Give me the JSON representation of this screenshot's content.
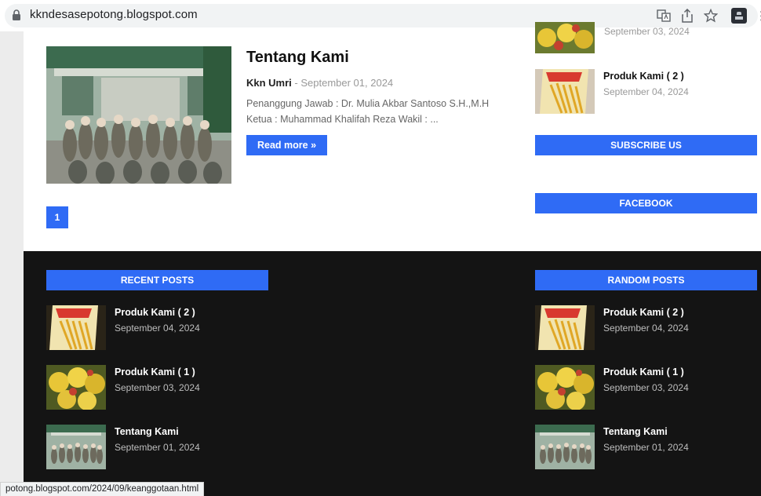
{
  "browser": {
    "url": "kkndesasepotong.blogspot.com",
    "status_url": "potong.blogspot.com/2024/09/keanggotaan.html",
    "more_glyph": "⋮"
  },
  "post": {
    "title": "Tentang Kami",
    "author": "Kkn Umri",
    "separator": " - ",
    "date": "September 01, 2024",
    "excerpt": "Penanggung Jawab : Dr. Mulia Akbar Santoso S.H.,M.H Ketua : Muhammad Khalifah Reza Wakil : ...",
    "read_more": "Read more »"
  },
  "pager": {
    "current": "1"
  },
  "sidebar": {
    "partial_item_date": "September 03, 2024",
    "item": {
      "title": "Produk Kami ( 2 )",
      "date": "September 04, 2024"
    },
    "subscribe_label": "SUBSCRIBE US",
    "facebook_label": "FACEBOOK"
  },
  "footer": {
    "recent_label": "RECENT POSTS",
    "random_label": "RANDOM POSTS",
    "recent": [
      {
        "title": "Produk Kami ( 2 )",
        "date": "September 04, 2024",
        "thumb": "snack"
      },
      {
        "title": "Produk Kami ( 1 )",
        "date": "September 03, 2024",
        "thumb": "fruit"
      },
      {
        "title": "Tentang Kami",
        "date": "September 01, 2024",
        "thumb": "group"
      }
    ],
    "random": [
      {
        "title": "Produk Kami ( 2 )",
        "date": "September 04, 2024",
        "thumb": "snack"
      },
      {
        "title": "Produk Kami ( 1 )",
        "date": "September 03, 2024",
        "thumb": "fruit"
      },
      {
        "title": "Tentang Kami",
        "date": "September 01, 2024",
        "thumb": "group"
      }
    ]
  },
  "colors": {
    "accent": "#2f6bf5",
    "footer_bg": "#141414"
  }
}
